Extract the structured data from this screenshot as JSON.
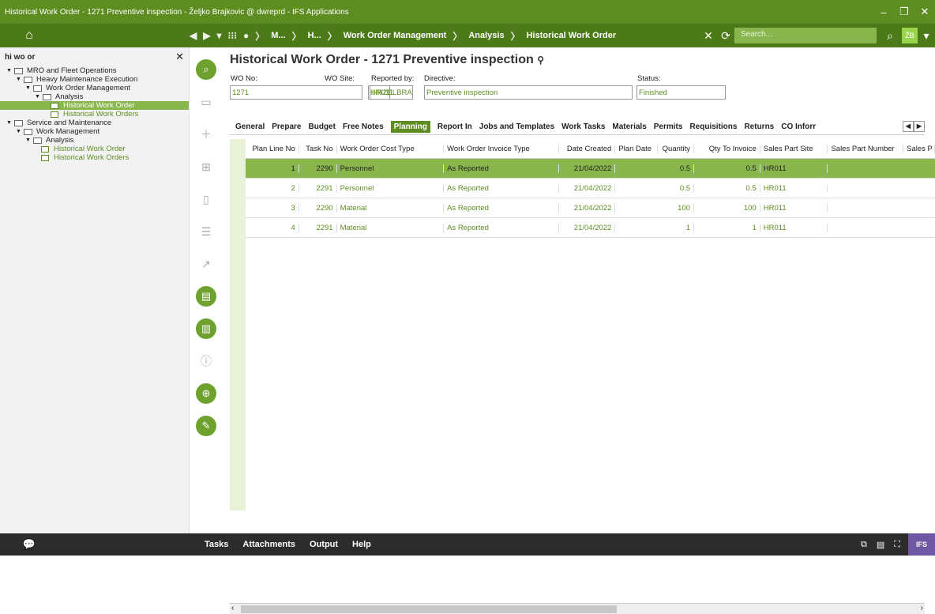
{
  "window": {
    "title": "Historical Work Order - 1271 Preventive inspection - Željko Brajkovic @ dwreprd - IFS Applications"
  },
  "nav": {
    "crumbs": [
      "M...",
      "H...",
      "Work Order Management",
      "Analysis",
      "Historical Work Order"
    ],
    "search_placeholder": "Search...",
    "user": "ŽB"
  },
  "navigator": {
    "query": "hi wo or",
    "items": [
      {
        "label": "MRO and Fleet Operations",
        "level": 0,
        "type": "folder"
      },
      {
        "label": "Heavy Maintenance Execution",
        "level": 1,
        "type": "folder"
      },
      {
        "label": "Work Order Management",
        "level": 2,
        "type": "folder"
      },
      {
        "label": "Analysis",
        "level": 3,
        "type": "folder"
      },
      {
        "label": "Historical Work Order",
        "level": 4,
        "type": "leaf",
        "selected": true
      },
      {
        "label": "Historical Work Orders",
        "level": 4,
        "type": "leaf"
      },
      {
        "label": "Service and Maintenance",
        "level": 0,
        "type": "folder"
      },
      {
        "label": "Work Management",
        "level": 1,
        "type": "folder"
      },
      {
        "label": "Analysis",
        "level": 2,
        "type": "folder"
      },
      {
        "label": "Historical Work Order",
        "level": 3,
        "type": "leaf"
      },
      {
        "label": "Historical Work Orders",
        "level": 3,
        "type": "leaf"
      }
    ]
  },
  "page": {
    "title": "Historical Work Order - 1271 Preventive inspection",
    "labels": {
      "wo_no": "WO No:",
      "wo_site": "WO Site:",
      "reported_by": "Reported by:",
      "directive": "Directive:",
      "status": "Status:"
    },
    "values": {
      "wo_no": "1271",
      "wo_site": "HR011",
      "reported_by": "HRZELBRA",
      "directive": "Preventive inspection",
      "status": "Finished"
    }
  },
  "tabs": [
    "General",
    "Prepare",
    "Budget",
    "Free Notes",
    "Planning",
    "Report In",
    "Jobs and Templates",
    "Work Tasks",
    "Materials",
    "Permits",
    "Requisitions",
    "Returns",
    "CO Inforr"
  ],
  "active_tab": "Planning",
  "grid": {
    "columns": [
      "Plan Line No",
      "Task No",
      "Work Order Cost Type",
      "Work Order Invoice Type",
      "Date Created",
      "Plan Date",
      "Quantity",
      "Qty To Invoice",
      "Sales Part Site",
      "Sales Part Number",
      "Sales P"
    ],
    "rows": [
      [
        "1",
        "2290",
        "Personnel",
        "As Reported",
        "21/04/2022",
        "",
        "0.5",
        "0.5",
        "HR011"
      ],
      [
        "2",
        "2291",
        "Personnel",
        "As Reported",
        "21/04/2022",
        "",
        "0.5",
        "0.5",
        "HR011"
      ],
      [
        "3",
        "2290",
        "Material",
        "As Reported",
        "21/04/2022",
        "",
        "100",
        "100",
        "HR011"
      ],
      [
        "4",
        "2291",
        "Material",
        "As Reported",
        "21/04/2022",
        "",
        "1",
        "1",
        "HR011"
      ]
    ]
  },
  "bottom": {
    "items": [
      "Tasks",
      "Attachments",
      "Output",
      "Help"
    ],
    "brand": "IFS"
  }
}
